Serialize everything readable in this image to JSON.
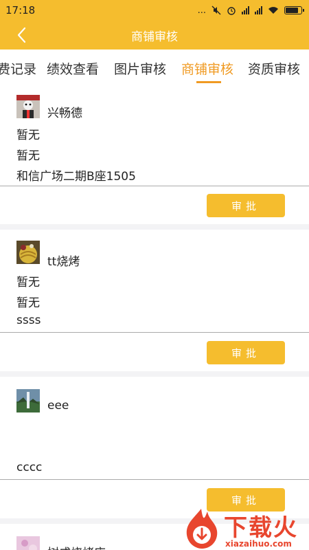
{
  "status": {
    "time": "17:18",
    "more": "...",
    "battery_level": 0.8
  },
  "header": {
    "title": "商铺审核"
  },
  "tabs": [
    {
      "label": "费记录",
      "active": false
    },
    {
      "label": "绩效查看",
      "active": false
    },
    {
      "label": "图片审核",
      "active": false
    },
    {
      "label": "商铺审核",
      "active": true
    },
    {
      "label": "资质审核",
      "active": false
    }
  ],
  "shops": [
    {
      "name": "兴畅德",
      "line1": "暂无",
      "line2": "暂无",
      "address": "和信广场二期B座1505",
      "approve_label": "审批"
    },
    {
      "name": "tt烧烤",
      "line1": "暂无",
      "line2": "暂无",
      "address": "ssss",
      "approve_label": "审批"
    },
    {
      "name": "eee",
      "line1": "",
      "line2": "",
      "address": "cccc",
      "approve_label": "审批"
    },
    {
      "name": "树成烧烤店"
    }
  ],
  "watermark": {
    "text": "下载火",
    "url": "xiazaihuo.com"
  },
  "colors": {
    "accent": "#f5bd2e",
    "tab_active": "#f09a22",
    "watermark": "#e8462e"
  }
}
